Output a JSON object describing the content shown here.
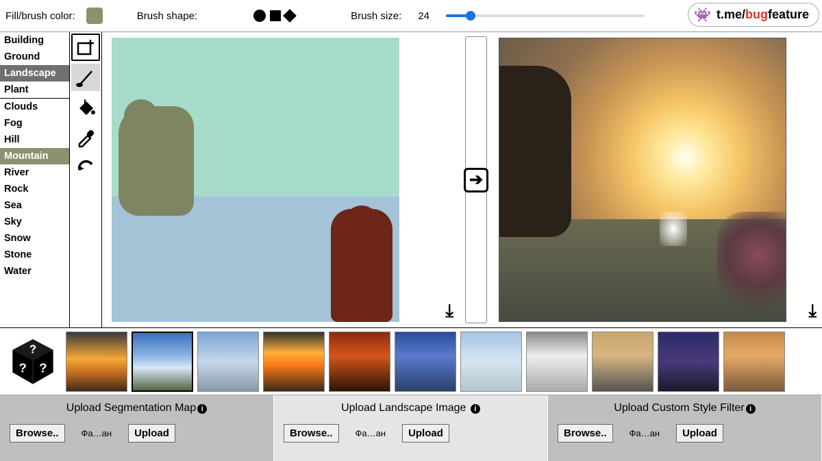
{
  "topbar": {
    "fill_label": "Fill/brush color:",
    "shape_label": "Brush shape:",
    "size_label": "Brush size:",
    "size_value": "24",
    "fill_color": "#8a926e",
    "slider_percent": 12
  },
  "badge": {
    "prefix": "t.me/",
    "bug": "bug",
    "feature": "feature"
  },
  "categories": {
    "group1": [
      "Building",
      "Ground",
      "Landscape",
      "Plant"
    ],
    "group2": [
      "Clouds",
      "Fog",
      "Hill",
      "Mountain",
      "River",
      "Rock",
      "Sea",
      "Sky",
      "Snow",
      "Stone",
      "Water"
    ],
    "selected1": "Landscape",
    "selected2": "Mountain"
  },
  "tools": [
    "add-rectangle",
    "brush",
    "fill-bucket",
    "eyedropper",
    "undo"
  ],
  "active_tool": "brush",
  "uploads": {
    "seg": {
      "title": "Upload Segmentation Map",
      "browse": "Browse..",
      "filename": "Фа…ан",
      "upload": "Upload"
    },
    "landscape": {
      "title": "Upload Landscape Image",
      "browse": "Browse..",
      "filename": "Фа…ан",
      "upload": "Upload"
    },
    "style": {
      "title": "Upload Custom Style Filter",
      "browse": "Browse..",
      "filename": "Фа…ан",
      "upload": "Upload"
    }
  },
  "style_thumbs": [
    "sunset1",
    "clouds",
    "sky2",
    "sunset2",
    "sunset3",
    "sea1",
    "snow1",
    "snow2",
    "clouds2",
    "night",
    "sunset4"
  ],
  "selected_thumb": 1
}
